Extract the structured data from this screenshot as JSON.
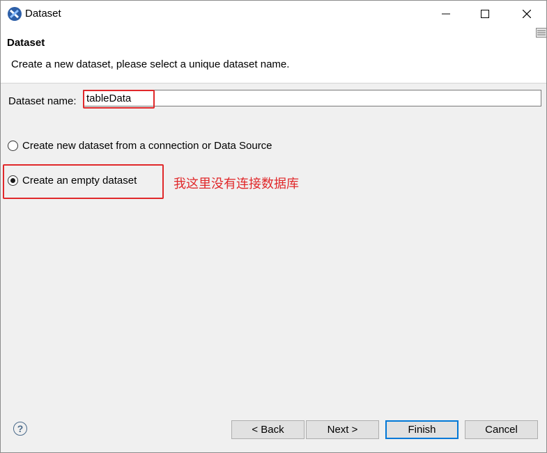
{
  "window": {
    "title": "Dataset"
  },
  "header": {
    "title": "Dataset",
    "description": "Create a new dataset, please select a unique dataset name."
  },
  "form": {
    "name_label": "Dataset name:",
    "name_value": "tableData",
    "options": [
      {
        "label": "Create new dataset from a connection or Data Source",
        "selected": false
      },
      {
        "label": "Create an empty dataset",
        "selected": true
      }
    ]
  },
  "annotation": {
    "text": "我这里没有连接数据库",
    "color": "#e0282a"
  },
  "buttons": {
    "help": "?",
    "back": "< Back",
    "next": "Next >",
    "finish": "Finish",
    "cancel": "Cancel"
  },
  "colors": {
    "highlight": "#e0282a",
    "accent": "#0078d7"
  }
}
